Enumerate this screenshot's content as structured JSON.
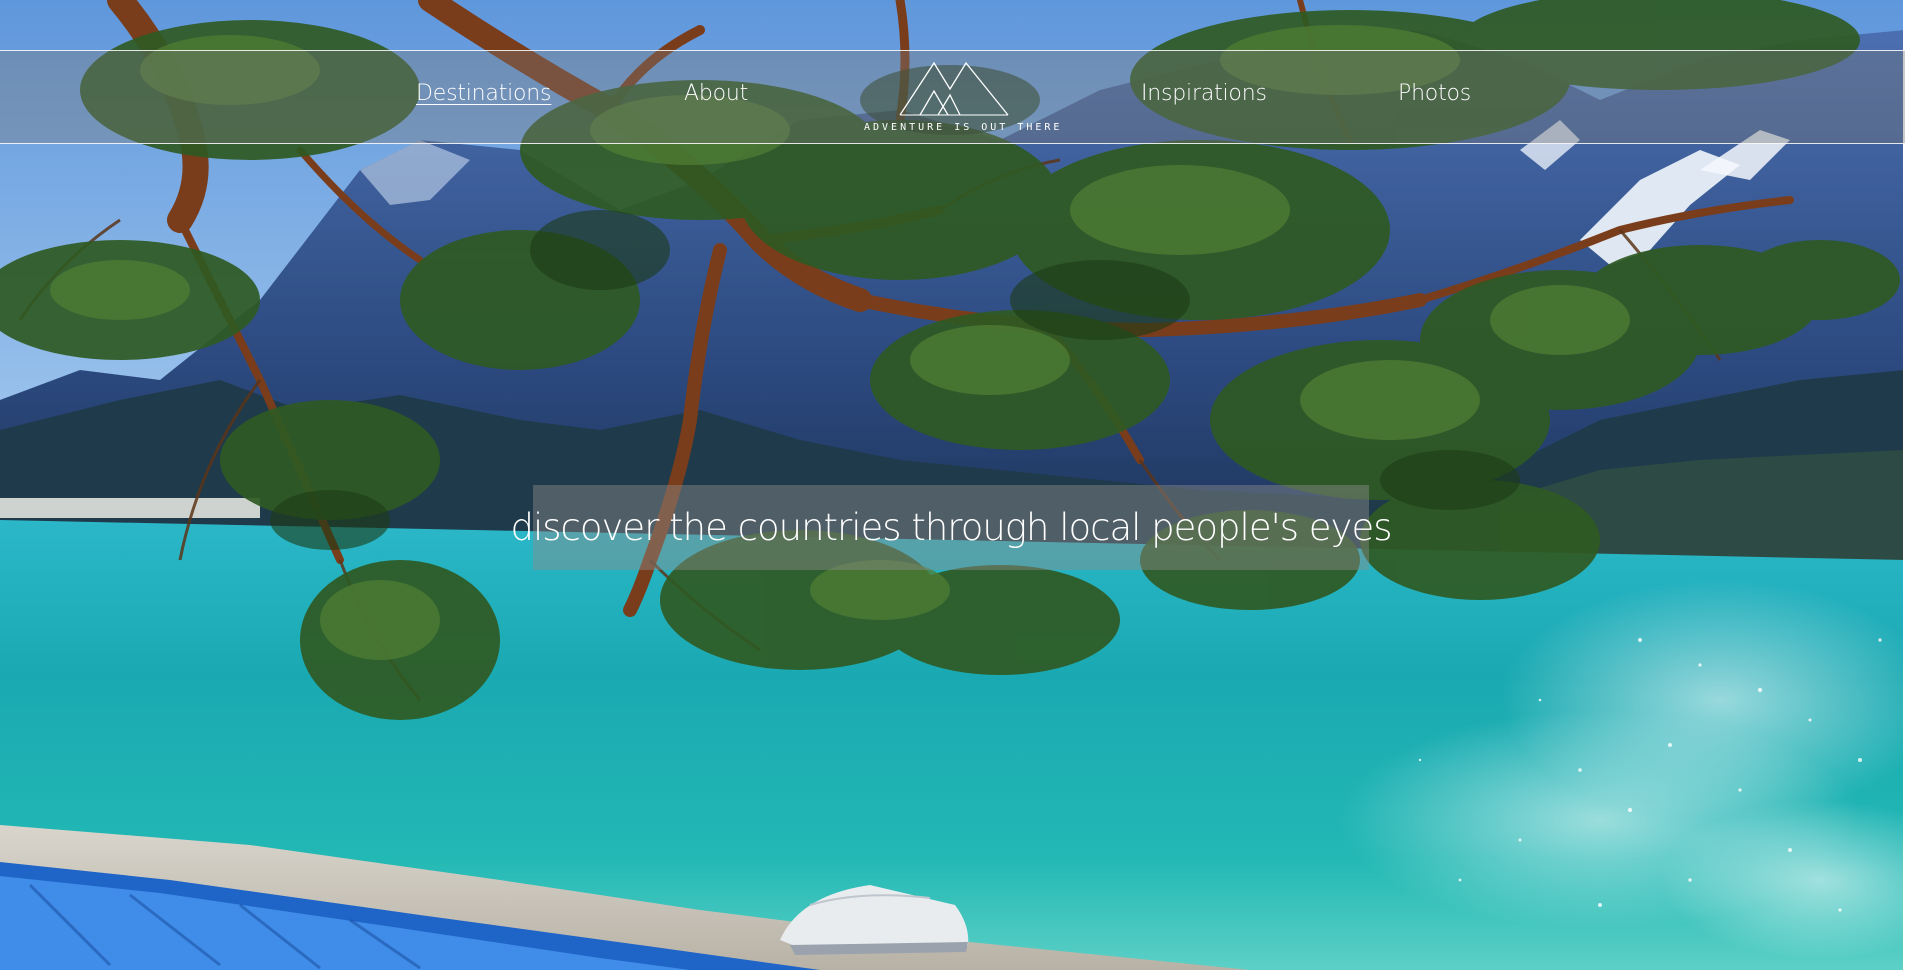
{
  "nav": {
    "links": [
      {
        "label": "Destinations",
        "active": true
      },
      {
        "label": "About",
        "active": false
      },
      {
        "label": "Inspirations",
        "active": false
      },
      {
        "label": "Photos",
        "active": false
      }
    ],
    "logo": {
      "text": "ADVENTURE IS OUT THERE",
      "icon": "mountain-icon"
    }
  },
  "hero": {
    "tagline": "discover the countries through local people's eyes",
    "background": "photo of pine tree branches over a turquoise alpine lake with pebble beach, mountains and an upturned boat"
  },
  "colors": {
    "nav_text": "#ffffff",
    "nav_bar": "#787878",
    "lake": "#1fb5b5",
    "sky": "#7fb4e6"
  }
}
